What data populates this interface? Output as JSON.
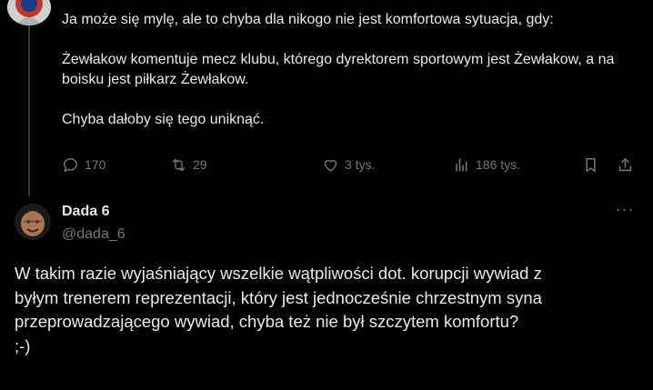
{
  "parent_tweet": {
    "avatar_icon": "user-avatar-icon",
    "paragraphs": [
      "Ja może się mylę, ale to chyba dla nikogo nie jest komfortowa sytuacja, gdy:",
      "Żewłakow komentuje mecz klubu, którego dyrektorem sportowym jest Żewłakow, a na boisku jest piłkarz Żewłakow.",
      "Chyba dałoby się tego uniknąć."
    ],
    "actions": {
      "replies": "170",
      "reposts": "29",
      "likes": "3 tys.",
      "views": "186 tys."
    }
  },
  "reply_tweet": {
    "display_name": "Dada 6",
    "handle": "@dada_6",
    "more_label": "···",
    "text_lines": [
      "W takim razie wyjaśniający wszelkie wątpliwości dot. korupcji wywiad z",
      "byłym trenerem reprezentacji, który jest jednocześnie chrzestnym syna",
      "przeprowadzającego wywiad, chyba też nie był szczytem komfortu?",
      ";-)"
    ]
  },
  "colors": {
    "background": "#000000",
    "text": "#e7e9ea",
    "muted": "#71767b",
    "thread_line": "#333639"
  }
}
